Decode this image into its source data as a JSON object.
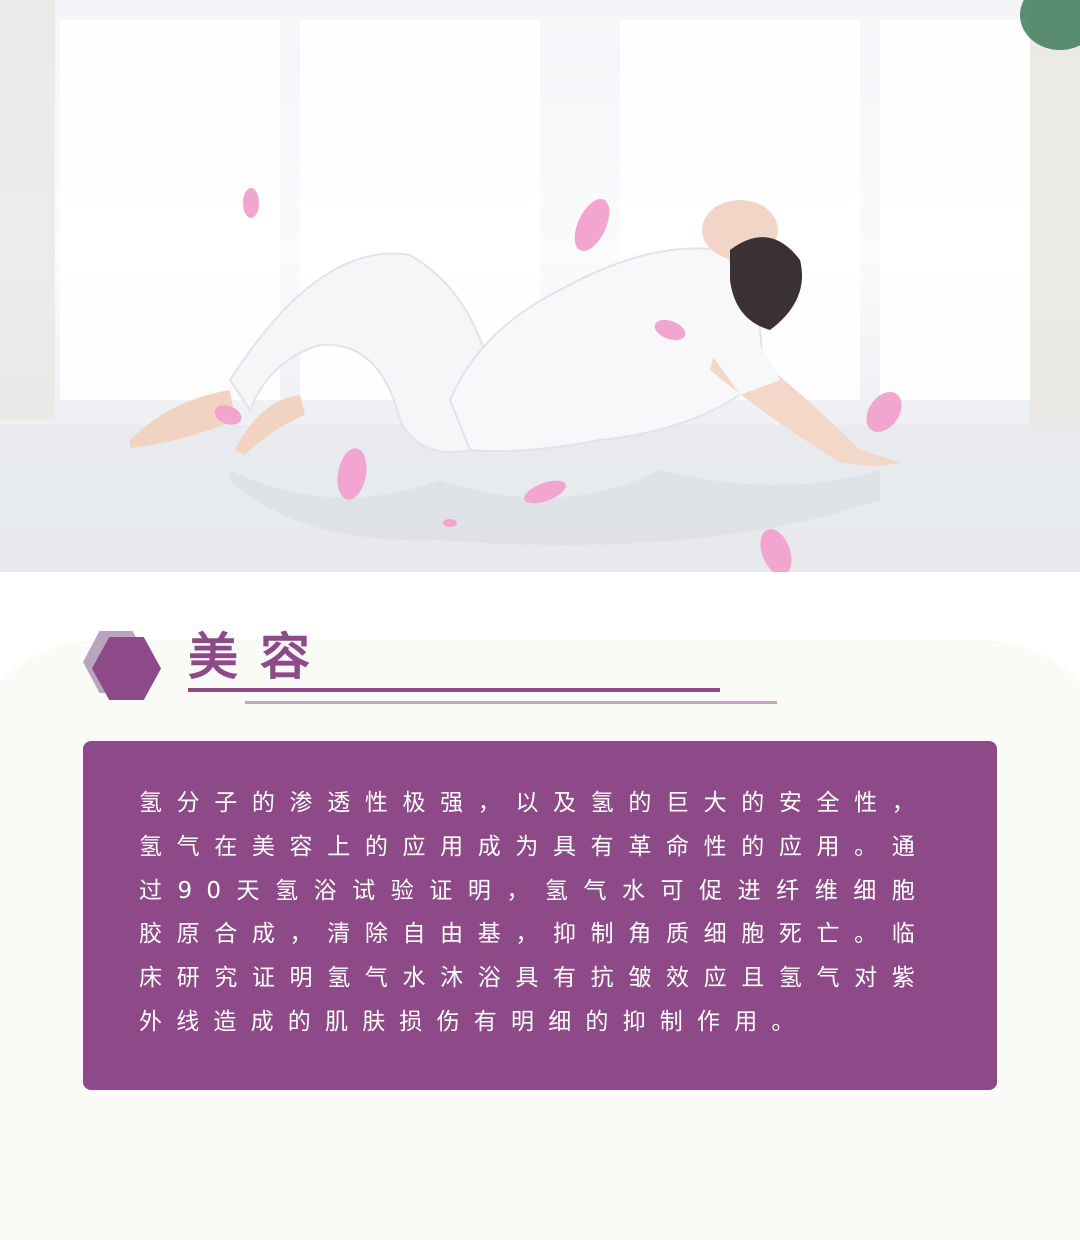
{
  "section": {
    "title": "美容",
    "body": "氢分子的渗透性极强，以及氢的巨大的安全性，氢气在美容上的应用成为具有革命性的应用。通过90天氢浴试验证明，氢气水可促进纤维细胞胶原合成，清除自由基，抑制角质细胞死亡。临床研究证明氢气水沐浴具有抗皱效应且氢气对紫外线造成的肌肤损伤有明细的抑制作用。"
  },
  "colors": {
    "accent": "#8e4a88",
    "accent_light": "#c0a6bf",
    "petal": "#f2a6cf"
  }
}
